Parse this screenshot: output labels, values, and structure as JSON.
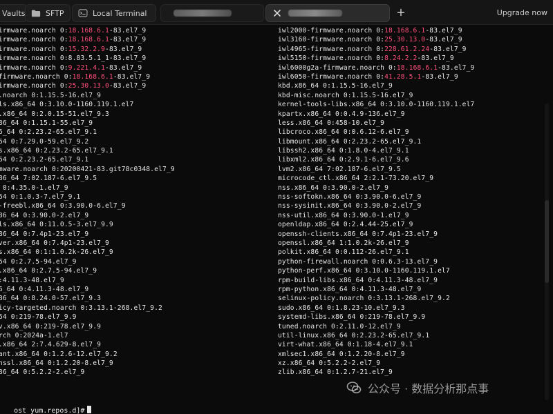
{
  "tabs": {
    "vaults": "Vaults",
    "sftp": "SFTP",
    "local_terminal": "Local Terminal",
    "upgrade": "Upgrade now"
  },
  "terminal": {
    "left_lines": [
      [
        [
          "firmware.noarch 0:",
          "normal"
        ],
        [
          "18.168.6.1",
          "pink"
        ],
        [
          "-83.el7_9",
          "normal"
        ]
      ],
      [
        [
          "firmware.noarch 0:",
          "normal"
        ],
        [
          "18.168.6.1",
          "pink"
        ],
        [
          "-83.el7_9",
          "normal"
        ]
      ],
      [
        [
          "firmware.noarch 0:",
          "normal"
        ],
        [
          "15.32.2.9",
          "pink"
        ],
        [
          "-83.el7_9",
          "normal"
        ]
      ],
      [
        [
          "firmware.noarch 0:8.83.5.1_1-83.el7_9",
          "normal"
        ]
      ],
      [
        [
          "firmware.noarch 0:",
          "normal"
        ],
        [
          "9.221.4.1",
          "pink"
        ],
        [
          "-83.el7_9",
          "normal"
        ]
      ],
      [
        [
          "-firmware.noarch 0:",
          "normal"
        ],
        [
          "18.168.6.1",
          "pink"
        ],
        [
          "-83.el7_9",
          "normal"
        ]
      ],
      [
        [
          "firmware.noarch 0:",
          "normal"
        ],
        [
          "25.30.13.0",
          "pink"
        ],
        [
          "-83.el7_9",
          "normal"
        ]
      ],
      [
        [
          "c.noarch 0:1.15.5-16.el7_9",
          "normal"
        ]
      ],
      [
        [
          "ols.x86_64 0:3.10.0-1160.119.1.el7",
          "normal"
        ]
      ],
      [
        [
          "s.x86_64 0:2.0.15-51.el7_9.3",
          "normal"
        ]
      ],
      [
        [
          "x86_64 0:1.15.1-55.el7_9",
          "normal"
        ]
      ],
      [
        [
          "86_64 0:2.23.2-65.el7_9.1",
          "normal"
        ]
      ],
      [
        [
          "_64 0:7.29.0-59.el7_9.2",
          "normal"
        ]
      ],
      [
        [
          "ls.x86_64 0:2.23.2-65.el7_9.1",
          "normal"
        ]
      ],
      [
        [
          "_64 0:2.23.2-65.el7_9.1",
          "normal"
        ]
      ],
      [
        [
          "rmware.noarch 0:20200421-83.git78c0348.el7_9",
          "normal"
        ]
      ],
      [
        [
          "x86_64 7:02.187-6.el7_9.5",
          "normal"
        ]
      ],
      [
        [
          "4 0:4.35.0-1.el7_9",
          "normal"
        ]
      ],
      [
        [
          "_64 0:1.0.3-7.el7_9.1",
          "normal"
        ]
      ],
      [
        [
          "n-freebl.x86_64 0:3.90.0-6.el7_9",
          "normal"
        ]
      ],
      [
        [
          "x86_64 0:3.90.0-2.el7_9",
          "normal"
        ]
      ],
      [
        [
          "ols.x86_64 0:11.0.5-3.el7_9.9",
          "normal"
        ]
      ],
      [
        [
          "x86_64 0:7.4p1-23.el7_9",
          "normal"
        ]
      ],
      [
        [
          "rver.x86_64 0:7.4p1-23.el7_9",
          "normal"
        ]
      ],
      [
        [
          "bs.x86_64 0:1:1.0.2k-26.el7_9",
          "normal"
        ]
      ],
      [
        [
          "_64 0:2.7.5-94.el7_9",
          "normal"
        ]
      ],
      [
        [
          "s.x86_64 0:2.7.5-94.el7_9",
          "normal"
        ]
      ],
      [
        [
          "0:4.11.3-48.el7_9",
          "normal"
        ]
      ],
      [
        [
          "86_64 0:4.11.3-48.el7_9",
          "normal"
        ]
      ],
      [
        [
          "x86_64 0:8.24.0-57.el7_9.3",
          "normal"
        ]
      ],
      [
        [
          "licy-targeted.noarch 0:3.13.1-268.el7_9.2",
          "normal"
        ]
      ],
      [
        [
          "_64 0:219-78.el7_9.9",
          "normal"
        ]
      ],
      [
        [
          "sv.x86_64 0:219-78.el7_9.9",
          "normal"
        ]
      ],
      [
        [
          "arch 0:2024a-1.el7",
          "normal"
        ]
      ],
      [
        [
          "l.x86_64 2:7.4.629-8.el7_9",
          "normal"
        ]
      ],
      [
        [
          "cant.x86_64 0:1.2.6-12.el7_9.2",
          "normal"
        ]
      ],
      [
        [
          "enssl.x86_64 0:1.2.20-8.el7_9",
          "normal"
        ]
      ],
      [
        [
          "x86_64 0:5.2.2-2.el7_9",
          "normal"
        ]
      ]
    ],
    "right_lines": [
      [
        [
          "iwl2000-firmware.noarch 0:",
          "normal"
        ],
        [
          "18.168.6.1",
          "pink"
        ],
        [
          "-83.el7_9",
          "normal"
        ]
      ],
      [
        [
          "iwl3160-firmware.noarch 0:",
          "normal"
        ],
        [
          "25.30.13.0",
          "pink"
        ],
        [
          "-83.el7_9",
          "normal"
        ]
      ],
      [
        [
          "iwl4965-firmware.noarch 0:",
          "normal"
        ],
        [
          "228.61.2.24",
          "pink"
        ],
        [
          "-83.el7_9",
          "normal"
        ]
      ],
      [
        [
          "iwl5150-firmware.noarch 0:",
          "normal"
        ],
        [
          "8.24.2.2",
          "pink"
        ],
        [
          "-83.el7_9",
          "normal"
        ]
      ],
      [
        [
          "iwl6000g2a-firmware.noarch 0:",
          "normal"
        ],
        [
          "18.168.6.1",
          "pink"
        ],
        [
          "-83.el7_9",
          "normal"
        ]
      ],
      [
        [
          "iwl6050-firmware.noarch 0:",
          "normal"
        ],
        [
          "41.28.5.1",
          "pink"
        ],
        [
          "-83.el7_9",
          "normal"
        ]
      ],
      [
        [
          "kbd.x86_64 0:1.15.5-16.el7_9",
          "normal"
        ]
      ],
      [
        [
          "kbd-misc.noarch 0:1.15.5-16.el7_9",
          "normal"
        ]
      ],
      [
        [
          "kernel-tools-libs.x86_64 0:3.10.0-1160.119.1.el7",
          "normal"
        ]
      ],
      [
        [
          "kpartx.x86_64 0:0.4.9-136.el7_9",
          "normal"
        ]
      ],
      [
        [
          "less.x86_64 0:458-10.el7_9",
          "normal"
        ]
      ],
      [
        [
          "libcroco.x86_64 0:0.6.12-6.el7_9",
          "normal"
        ]
      ],
      [
        [
          "libmount.x86_64 0:2.23.2-65.el7_9.1",
          "normal"
        ]
      ],
      [
        [
          "libssh2.x86_64 0:1.8.0-4.el7_9.1",
          "normal"
        ]
      ],
      [
        [
          "libxml2.x86_64 0:2.9.1-6.el7_9.6",
          "normal"
        ]
      ],
      [
        [
          "lvm2.x86_64 7:02.187-6.el7_9.5",
          "normal"
        ]
      ],
      [
        [
          "microcode_ctl.x86_64 2:2.1-73.20.el7_9",
          "normal"
        ]
      ],
      [
        [
          "nss.x86_64 0:3.90.0-2.el7_9",
          "normal"
        ]
      ],
      [
        [
          "nss-softokn.x86_64 0:3.90.0-6.el7_9",
          "normal"
        ]
      ],
      [
        [
          "nss-sysinit.x86_64 0:3.90.0-2.el7_9",
          "normal"
        ]
      ],
      [
        [
          "nss-util.x86_64 0:3.90.0-1.el7_9",
          "normal"
        ]
      ],
      [
        [
          "openldap.x86_64 0:2.4.44-25.el7_9",
          "normal"
        ]
      ],
      [
        [
          "openssh-clients.x86_64 0:7.4p1-23.el7_9",
          "normal"
        ]
      ],
      [
        [
          "openssl.x86_64 1:1.0.2k-26.el7_9",
          "normal"
        ]
      ],
      [
        [
          "polkit.x86_64 0:0.112-26.el7_9.1",
          "normal"
        ]
      ],
      [
        [
          "python-firewall.noarch 0:0.6.3-13.el7_9",
          "normal"
        ]
      ],
      [
        [
          "python-perf.x86_64 0:3.10.0-1160.119.1.el7",
          "normal"
        ]
      ],
      [
        [
          "rpm-build-libs.x86_64 0:4.11.3-48.el7_9",
          "normal"
        ]
      ],
      [
        [
          "rpm-python.x86_64 0:4.11.3-48.el7_9",
          "normal"
        ]
      ],
      [
        [
          "selinux-policy.noarch 0:3.13.1-268.el7_9.2",
          "normal"
        ]
      ],
      [
        [
          "sudo.x86_64 0:1.8.23-10.el7_9.3",
          "normal"
        ]
      ],
      [
        [
          "systemd-libs.x86_64 0:219-78.el7_9.9",
          "normal"
        ]
      ],
      [
        [
          "tuned.noarch 0:2.11.0-12.el7_9",
          "normal"
        ]
      ],
      [
        [
          "util-linux.x86_64 0:2.23.2-65.el7_9.1",
          "normal"
        ]
      ],
      [
        [
          "virt-what.x86_64 0:1.18-4.el7_9.1",
          "normal"
        ]
      ],
      [
        [
          "xmlsec1.x86_64 0:1.2.20-8.el7_9",
          "normal"
        ]
      ],
      [
        [
          "xz.x86_64 0:5.2.2-2.el7_9",
          "normal"
        ]
      ],
      [
        [
          "zlib.x86_64 0:1.2.7-21.el7_9",
          "normal"
        ]
      ]
    ],
    "prompt": "ost yum.repos.d]#"
  },
  "watermark": {
    "text": "公众号 · 数据分析那点事"
  },
  "colors": {
    "background": "#0b0b0b",
    "text": "#e8e8e8",
    "highlight": "#ff4f7b"
  }
}
